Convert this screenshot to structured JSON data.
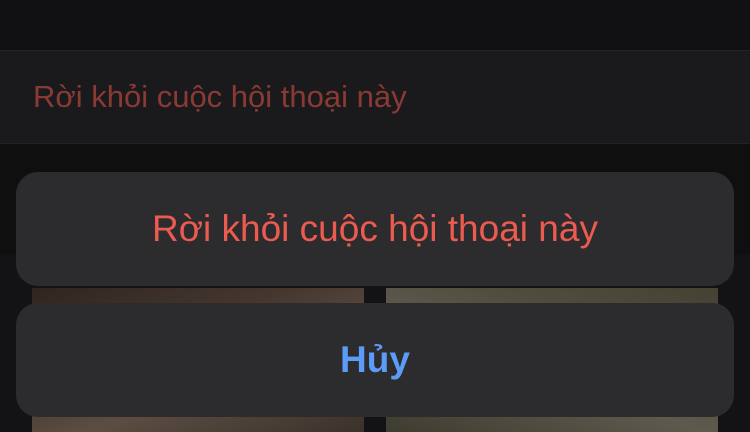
{
  "background": {
    "settings_row": {
      "label": "Rời khỏi cuộc hội thoại này"
    }
  },
  "action_sheet": {
    "leave_button_label": "Rời khỏi cuộc hội thoại này",
    "cancel_button_label": "Hủy"
  },
  "colors": {
    "destructive": "#ec5b4f",
    "cancel": "#5b9cf6",
    "sheet_background": "#2c2c2e"
  }
}
